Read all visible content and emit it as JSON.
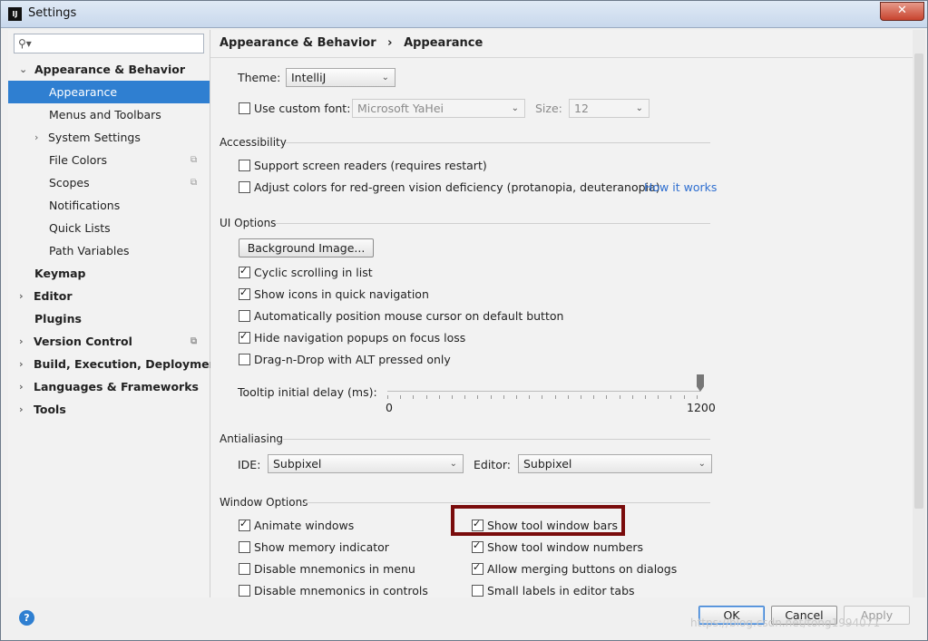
{
  "window": {
    "title": "Settings",
    "app_icon": "IJ",
    "close": "✕"
  },
  "search": {
    "placeholder": "",
    "icon": "search-icon"
  },
  "sidebar": {
    "items": [
      {
        "label": "Appearance & Behavior",
        "expanded": true
      },
      {
        "label": "Appearance",
        "selected": true
      },
      {
        "label": "Menus and Toolbars"
      },
      {
        "label": "System Settings"
      },
      {
        "label": "File Colors"
      },
      {
        "label": "Scopes"
      },
      {
        "label": "Notifications"
      },
      {
        "label": "Quick Lists"
      },
      {
        "label": "Path Variables"
      },
      {
        "label": "Keymap"
      },
      {
        "label": "Editor"
      },
      {
        "label": "Plugins"
      },
      {
        "label": "Version Control"
      },
      {
        "label": "Build, Execution, Deployment"
      },
      {
        "label": "Languages & Frameworks"
      },
      {
        "label": "Tools"
      }
    ]
  },
  "breadcrumb": {
    "parent": "Appearance & Behavior",
    "separator": "›",
    "current": "Appearance"
  },
  "theme": {
    "label": "Theme:",
    "value": "IntelliJ"
  },
  "custom_font": {
    "label": "Use custom font:",
    "checked": false,
    "font": "Microsoft YaHei",
    "size_label": "Size:",
    "size": "12"
  },
  "accessibility": {
    "title": "Accessibility",
    "screen_readers": "Support screen readers (requires restart)",
    "adjust_colors": "Adjust colors for red-green vision deficiency (protanopia, deuteranopia)",
    "how_it_works": "How it works"
  },
  "ui_options": {
    "title": "UI Options",
    "background_image": "Background Image...",
    "cyclic_scrolling": "Cyclic scrolling in list",
    "show_icons": "Show icons in quick navigation",
    "auto_position": "Automatically position mouse cursor on default button",
    "hide_popups": "Hide navigation popups on focus loss",
    "drag_n_drop": "Drag-n-Drop with ALT pressed only",
    "tooltip_label": "Tooltip initial delay (ms):",
    "tooltip_min": "0",
    "tooltip_max": "1200",
    "tooltip_value_fraction": 1.0
  },
  "antialiasing": {
    "title": "Antialiasing",
    "ide_label": "IDE:",
    "ide_value": "Subpixel",
    "editor_label": "Editor:",
    "editor_value": "Subpixel"
  },
  "window_options": {
    "title": "Window Options",
    "animate_windows": "Animate windows",
    "show_memory": "Show memory indicator",
    "disable_mnemonics_menu": "Disable mnemonics in menu",
    "disable_mnemonics_controls": "Disable mnemonics in controls",
    "show_tool_window_bars": "Show tool window bars",
    "show_tool_window_numbers": "Show tool window numbers",
    "allow_merging": "Allow merging buttons on dialogs",
    "small_labels": "Small labels in editor tabs"
  },
  "footer": {
    "help": "?",
    "ok": "OK",
    "cancel": "Cancel",
    "apply": "Apply"
  },
  "watermark": "https://blog.csdn.net/tong1994071",
  "colors": {
    "selection": "#2f7fd1",
    "highlight_box": "#7a0c0c",
    "link": "#2f6fd0"
  }
}
